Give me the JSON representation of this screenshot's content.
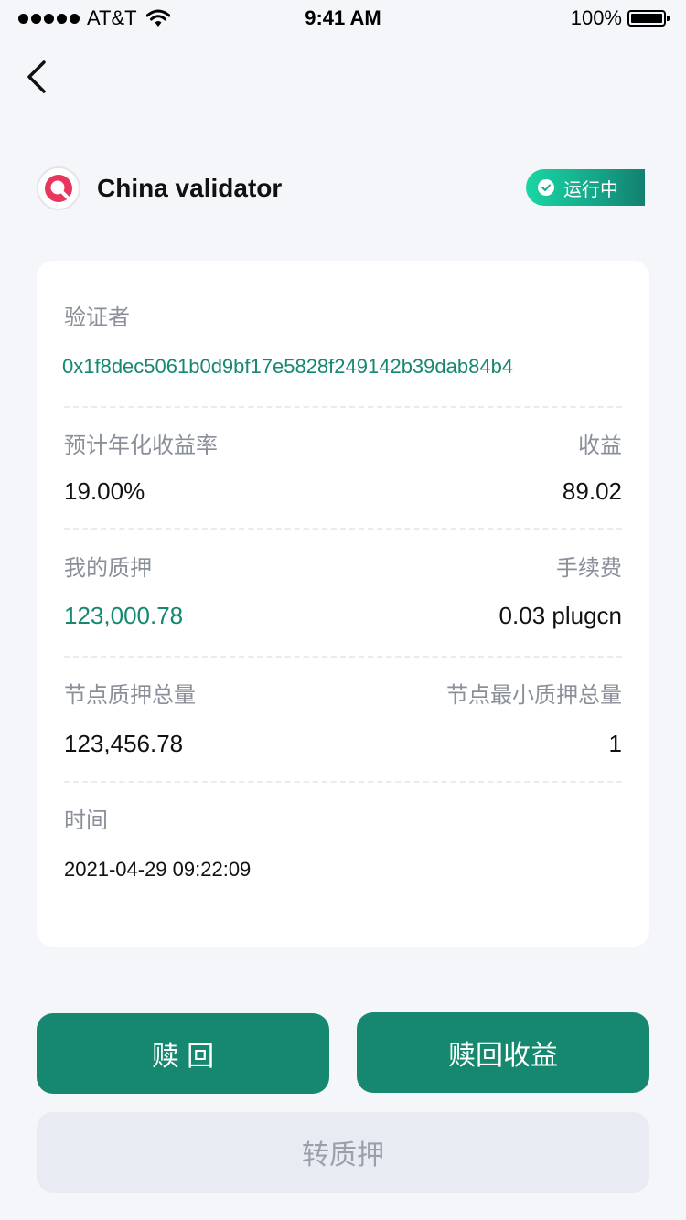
{
  "status_bar": {
    "carrier": "AT&T",
    "time": "9:41 AM",
    "battery": "100%"
  },
  "validator": {
    "name": "China validator",
    "status": "运行中"
  },
  "details": {
    "validator_label": "验证者",
    "validator_address": "0x1f8dec5061b0d9bf17e5828f249142b39dab84b4",
    "apr_label": "预计年化收益率",
    "apr_value": "19.00%",
    "earnings_label": "收益",
    "earnings_value": "89.02",
    "my_stake_label": "我的质押",
    "my_stake_value": "123,000.78",
    "fee_label": "手续费",
    "fee_value": "0.03 plugcn",
    "node_total_label": "节点质押总量",
    "node_total_value": "123,456.78",
    "node_min_label": "节点最小质押总量",
    "node_min_value": "1",
    "time_label": "时间",
    "time_value": "2021-04-29 09:22:09"
  },
  "actions": {
    "redeem": "赎 回",
    "redeem_earnings": "赎回收益",
    "transfer_stake": "转质押"
  },
  "colors": {
    "accent": "#16886f",
    "badge_start": "#1ad6a4",
    "page_bg": "#f5f6fa",
    "disabled_bg": "#e9ebf2"
  }
}
